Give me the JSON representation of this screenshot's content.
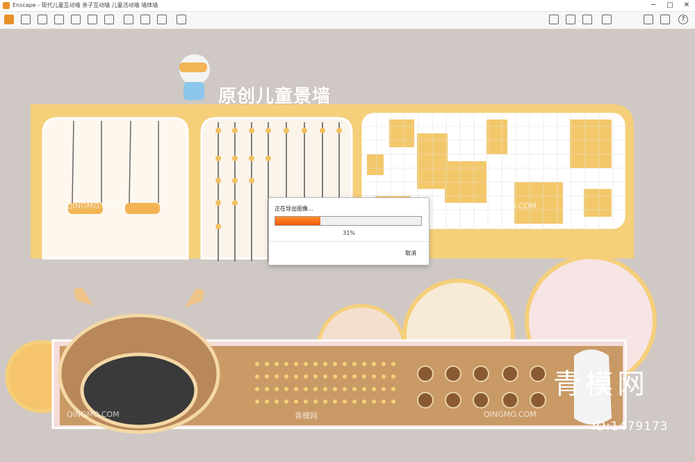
{
  "window": {
    "title": "Enscape - 现代儿童互动墙 亲子互动墙 儿童活动墙 墙体墙",
    "min": "─",
    "max": "□",
    "close": "✕"
  },
  "toolbar": {
    "left_icons": [
      "home-icon",
      "brush-icon",
      "list-icon",
      "gamepad-icon",
      "binoculars-icon",
      "cube-icon",
      "pen-icon",
      "camera-icon",
      "gallery-icon",
      "grid-icon",
      "export-icon"
    ],
    "right_icons": [
      "asset-library-icon",
      "video-icon",
      "cloud-icon",
      "eye-icon",
      "settings-icon",
      "help-icon"
    ],
    "help_label": "?"
  },
  "scene": {
    "title": "原创儿童景墙",
    "watermarks": [
      "青模网",
      "QINGMO.COM",
      "青模网"
    ],
    "big_watermark": "青模网",
    "id_text": "ID:1479173"
  },
  "export_dialog": {
    "title": "正在导出图像…",
    "progress": 0.31,
    "progress_text": "31%",
    "cancel_label": "取消",
    "accent": "#f36a12"
  },
  "colors": {
    "wall_yellow": "#f5cf7a",
    "background": "#cfc8c4",
    "wood": "#c99a66"
  }
}
